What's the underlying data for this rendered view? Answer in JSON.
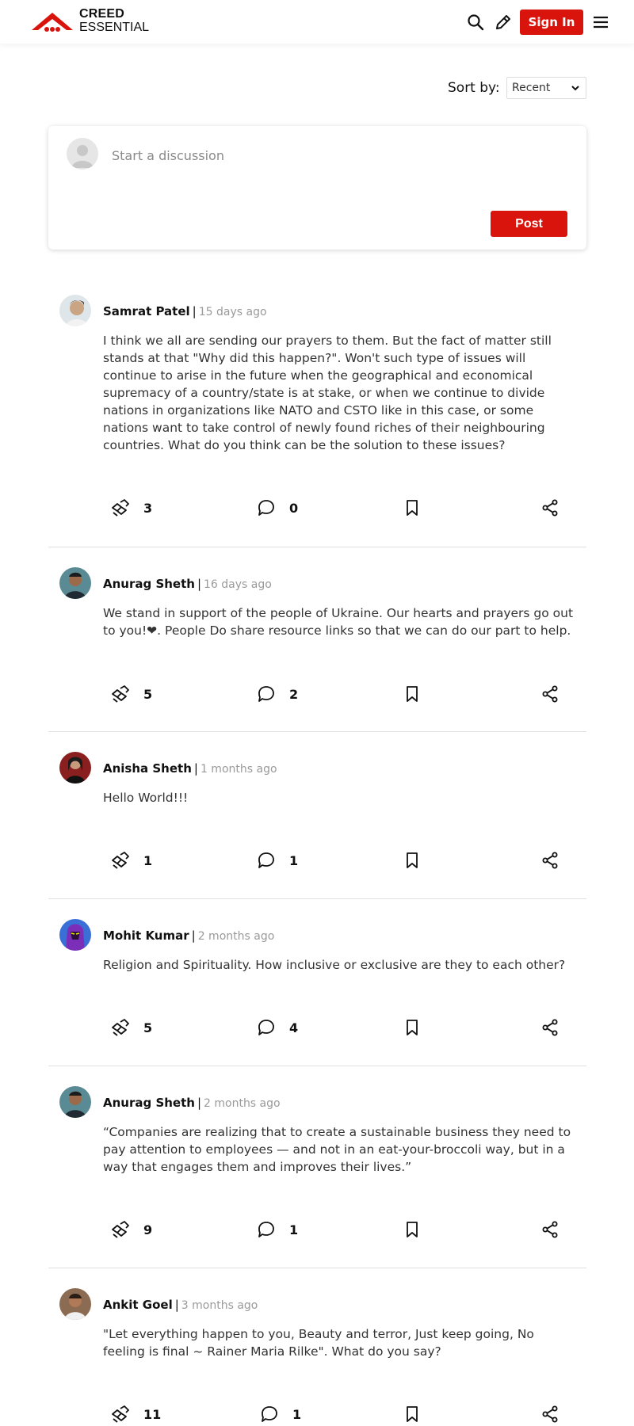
{
  "brand": {
    "line1": "CREED",
    "line2": "ESSENTIAL",
    "accent": "#d9140c"
  },
  "header": {
    "search_icon": "search-icon",
    "write_icon": "pencil-icon",
    "signin_label": "Sign In",
    "menu_icon": "menu-icon"
  },
  "sort": {
    "label": "Sort by:",
    "selected": "Recent"
  },
  "composer": {
    "placeholder": "Start a discussion",
    "post_label": "Post"
  },
  "posts": [
    {
      "author": "Samrat Patel",
      "time": "15 days ago",
      "body": "I think we all are sending our prayers to them. But the fact of matter still stands at that \"Why did this happen?\". Won't such type of issues will continue to arise in the future when the geographical and economical supremacy of a country/state is at stake, or when we continue to divide nations in organizations like NATO and CSTO like in this case, or some nations want to take control of newly found riches of their neighbouring countries. What do you think can be the solution to these issues?",
      "likes": "3",
      "comments": "0"
    },
    {
      "author": "Anurag Sheth",
      "time": "16 days ago",
      "body": "We stand in support of the people of Ukraine. Our hearts and prayers go out to you!❤. People Do share resource links so that we can do our part to help.",
      "likes": "5",
      "comments": "2"
    },
    {
      "author": "Anisha Sheth",
      "time": "1 months ago",
      "body": "Hello World!!!",
      "likes": "1",
      "comments": "1"
    },
    {
      "author": "Mohit Kumar",
      "time": "2 months ago",
      "body": "Religion and Spirituality. How inclusive or exclusive are they to each other?",
      "likes": "5",
      "comments": "4"
    },
    {
      "author": "Anurag Sheth",
      "time": "2 months ago",
      "body": "“Companies are realizing that to create a sustainable business they need to pay attention to employees — and not in an eat-your-broccoli way, but in a way that engages them and improves their lives.”",
      "likes": "9",
      "comments": "1"
    },
    {
      "author": "Ankit Goel",
      "time": "3 months ago",
      "body": "\"Let everything happen to you, Beauty and terror, Just keep going, No feeling is final ~ Rainer Maria Rilke\". What do you say?",
      "likes": "11",
      "comments": "1"
    }
  ]
}
